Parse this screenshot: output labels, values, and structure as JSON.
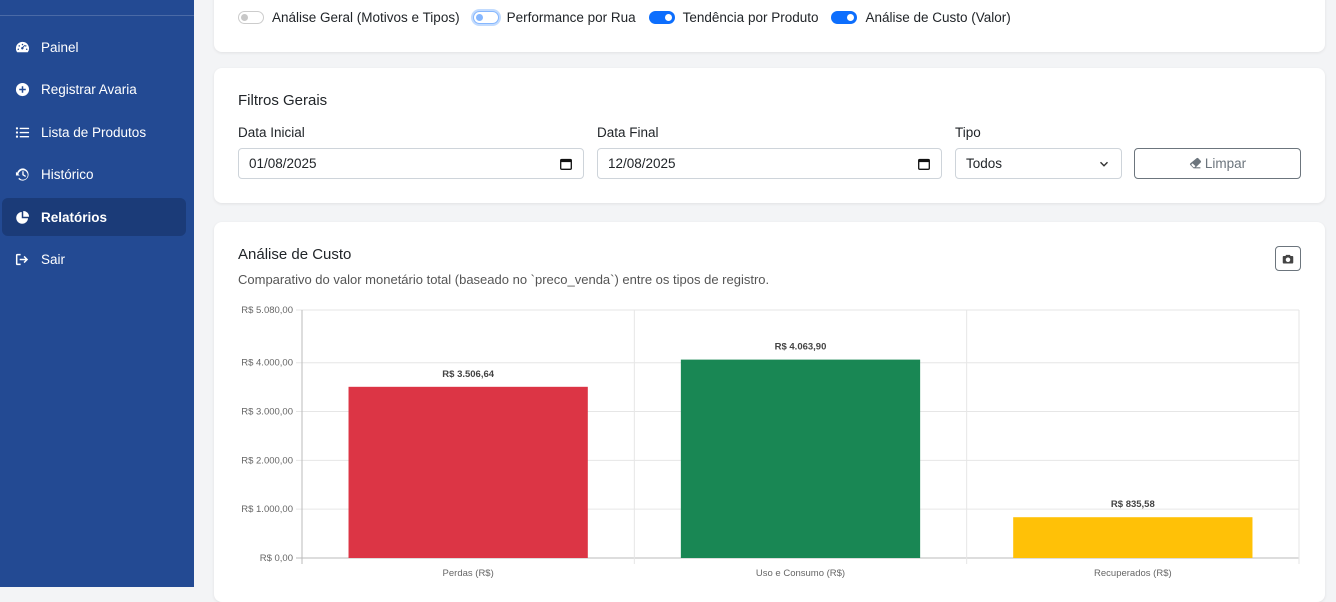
{
  "sidebar": {
    "items": [
      {
        "label": "Painel",
        "icon": "gauge-icon"
      },
      {
        "label": "Registrar Avaria",
        "icon": "plus-circle-icon"
      },
      {
        "label": "Lista de Produtos",
        "icon": "list-icon"
      },
      {
        "label": "Histórico",
        "icon": "history-icon"
      },
      {
        "label": "Relatórios",
        "icon": "pie-chart-icon"
      },
      {
        "label": "Sair",
        "icon": "logout-icon"
      }
    ]
  },
  "toggles": [
    {
      "label": "Análise Geral (Motivos e Tipos)",
      "on": false
    },
    {
      "label": "Performance por Rua",
      "on": false
    },
    {
      "label": "Tendência por Produto",
      "on": true
    },
    {
      "label": "Análise de Custo (Valor)",
      "on": true
    }
  ],
  "filters": {
    "title": "Filtros Gerais",
    "start_label": "Data Inicial",
    "start_value": "01/08/2025",
    "end_label": "Data Final",
    "end_value": "12/08/2025",
    "type_label": "Tipo",
    "type_value": "Todos",
    "clear_label": "Limpar"
  },
  "cost": {
    "title": "Análise de Custo",
    "subtitle": "Comparativo do valor monetário total (baseado no `preco_venda`) entre os tipos de registro."
  },
  "chart_data": {
    "type": "bar",
    "categories": [
      "Perdas (R$)",
      "Uso e Consumo (R$)",
      "Recuperados (R$)"
    ],
    "values": [
      3506.64,
      4063.9,
      835.58
    ],
    "data_labels": [
      "R$ 3.506,64",
      "R$ 4.063,90",
      "R$ 835,58"
    ],
    "colors": [
      "#dc3545",
      "#198754",
      "#ffc107"
    ],
    "ylim": [
      0,
      5080
    ],
    "yticks": [
      0,
      1000,
      2000,
      3000,
      4000,
      5080
    ],
    "ytick_labels": [
      "R$ 0,00",
      "R$ 1.000,00",
      "R$ 2.000,00",
      "R$ 3.000,00",
      "R$ 4.000,00",
      "R$ 5.080,00"
    ],
    "grid": true,
    "legend": "none"
  }
}
